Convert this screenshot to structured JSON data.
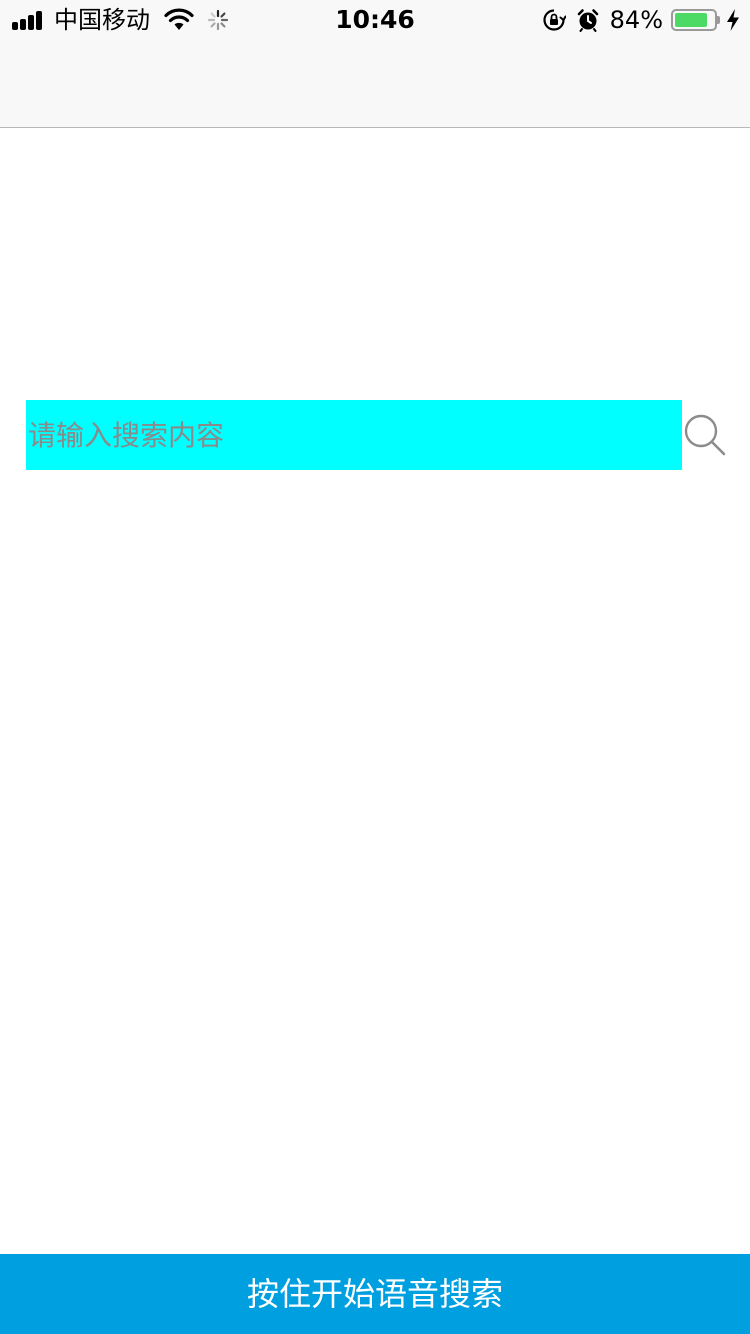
{
  "status_bar": {
    "carrier": "中国移动",
    "time": "10:46",
    "battery_percent": "84%",
    "battery_level": 0.84,
    "signal_bars": 4,
    "icons": [
      "signal-icon",
      "wifi-icon",
      "activity-spinner-icon",
      "rotation-lock-icon",
      "alarm-icon",
      "battery-icon",
      "charging-bolt-icon"
    ],
    "battery_color": "#4cd964"
  },
  "search": {
    "placeholder": "请输入搜索内容",
    "value": "",
    "input_bg": "#00ffff",
    "button_icon": "search-icon"
  },
  "voice_button": {
    "label": "按住开始语音搜索",
    "bg": "#00a0e0"
  }
}
